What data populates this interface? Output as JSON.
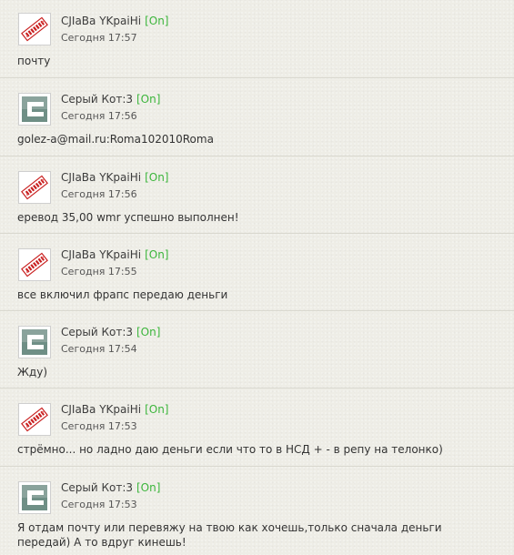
{
  "messages": [
    {
      "author": "CJIaBa YKpaiHi",
      "status": "[On]",
      "time": "Сегодня 17:57",
      "text": "почту",
      "avatar": "red-stamp-avatar"
    },
    {
      "author": "Серый Кот:3",
      "status": "[On]",
      "time": "Сегодня 17:56",
      "text": "golez-a@mail.ru:Roma102010Roma",
      "avatar": "grey-c-logo-avatar"
    },
    {
      "author": "CJIaBa YKpaiHi",
      "status": "[On]",
      "time": "Сегодня 17:56",
      "text": "еревод 35,00 wmr успешно выполнен!",
      "avatar": "red-stamp-avatar"
    },
    {
      "author": "CJIaBa YKpaiHi",
      "status": "[On]",
      "time": "Сегодня 17:55",
      "text": "все включил фрапс передаю деньги",
      "avatar": "red-stamp-avatar"
    },
    {
      "author": "Серый Кот:3",
      "status": "[On]",
      "time": "Сегодня 17:54",
      "text": "Жду)",
      "avatar": "grey-c-logo-avatar"
    },
    {
      "author": "CJIaBa YKpaiHi",
      "status": "[On]",
      "time": "Сегодня 17:53",
      "text": "стрёмно... но ладно даю деньги если что то в НСД + - в репу на телонко)",
      "avatar": "red-stamp-avatar"
    },
    {
      "author": "Серый Кот:3",
      "status": "[On]",
      "time": "Сегодня 17:53",
      "text": "Я отдам почту или перевяжу на твою как хочешь,только сначала деньги передай) А то вдруг кинешь!",
      "avatar": "grey-c-logo-avatar"
    }
  ],
  "colors": {
    "online_status": "#3bb53b",
    "background": "#eeede6",
    "divider": "#d9d8cf"
  }
}
